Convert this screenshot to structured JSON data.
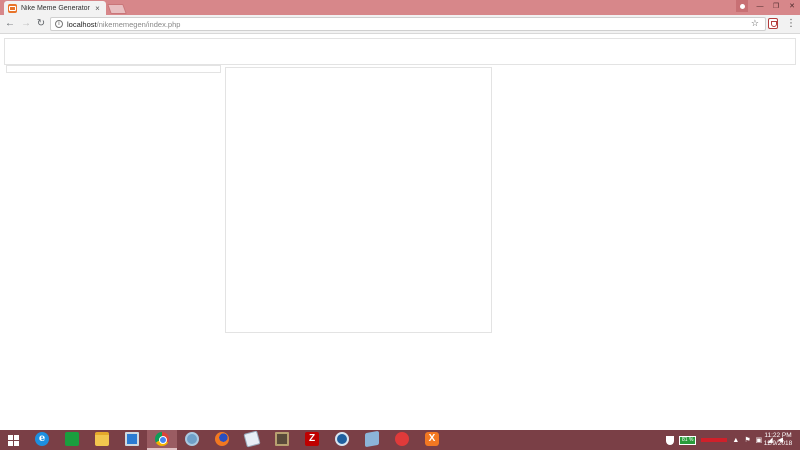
{
  "browser": {
    "tab": {
      "title": "Nike Meme Generator",
      "close_glyph": "×"
    },
    "window_controls": {
      "minimize": "—",
      "maximize": "❐",
      "close": "✕"
    },
    "nav": {
      "back": "←",
      "forward": "→",
      "reload": "↻"
    },
    "address": {
      "info_glyph": "i",
      "host": "localhost",
      "path": "/nikememegen/index.php"
    },
    "bookmark_glyph": "☆",
    "menu_glyph": "⋮"
  },
  "taskbar": {
    "apps": [
      {
        "name": "internet-explorer",
        "glyph": "e"
      },
      {
        "name": "store",
        "glyph": ""
      },
      {
        "name": "file-explorer",
        "glyph": ""
      },
      {
        "name": "remote-desktop",
        "glyph": ""
      },
      {
        "name": "chrome",
        "glyph": "",
        "active": true
      },
      {
        "name": "network-globe",
        "glyph": ""
      },
      {
        "name": "firefox",
        "glyph": ""
      },
      {
        "name": "document-app",
        "glyph": ""
      },
      {
        "name": "laptop-app",
        "glyph": ""
      },
      {
        "name": "filezilla",
        "glyph": "Z"
      },
      {
        "name": "blue-circle-app",
        "glyph": ""
      },
      {
        "name": "box-app",
        "glyph": ""
      },
      {
        "name": "mail-app",
        "glyph": ""
      },
      {
        "name": "xampp",
        "glyph": "X"
      }
    ],
    "tray": {
      "battery": "81 %",
      "up_arrow": "▲",
      "flag": "⚑",
      "network": "▣",
      "signal": "◢",
      "volume": "◀"
    },
    "clock": {
      "time": "11:22 PM",
      "date": "11/9/2018"
    }
  }
}
